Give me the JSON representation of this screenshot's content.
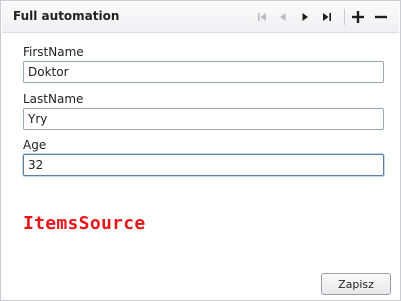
{
  "header": {
    "title": "Full automation"
  },
  "toolbar": {
    "icons": [
      "first-page-icon",
      "previous-icon",
      "next-icon",
      "last-page-icon",
      "add-icon",
      "remove-icon"
    ]
  },
  "form": {
    "first_name": {
      "label": "FirstName",
      "value": "Doktor"
    },
    "last_name": {
      "label": "LastName",
      "value": "Yry"
    },
    "age": {
      "label": "Age",
      "value": "32"
    }
  },
  "items_source_text": "ItemsSource",
  "save_label": "Zapisz",
  "colors": {
    "accent_red": "#e8161b",
    "focus_border": "#5d7e9c"
  }
}
